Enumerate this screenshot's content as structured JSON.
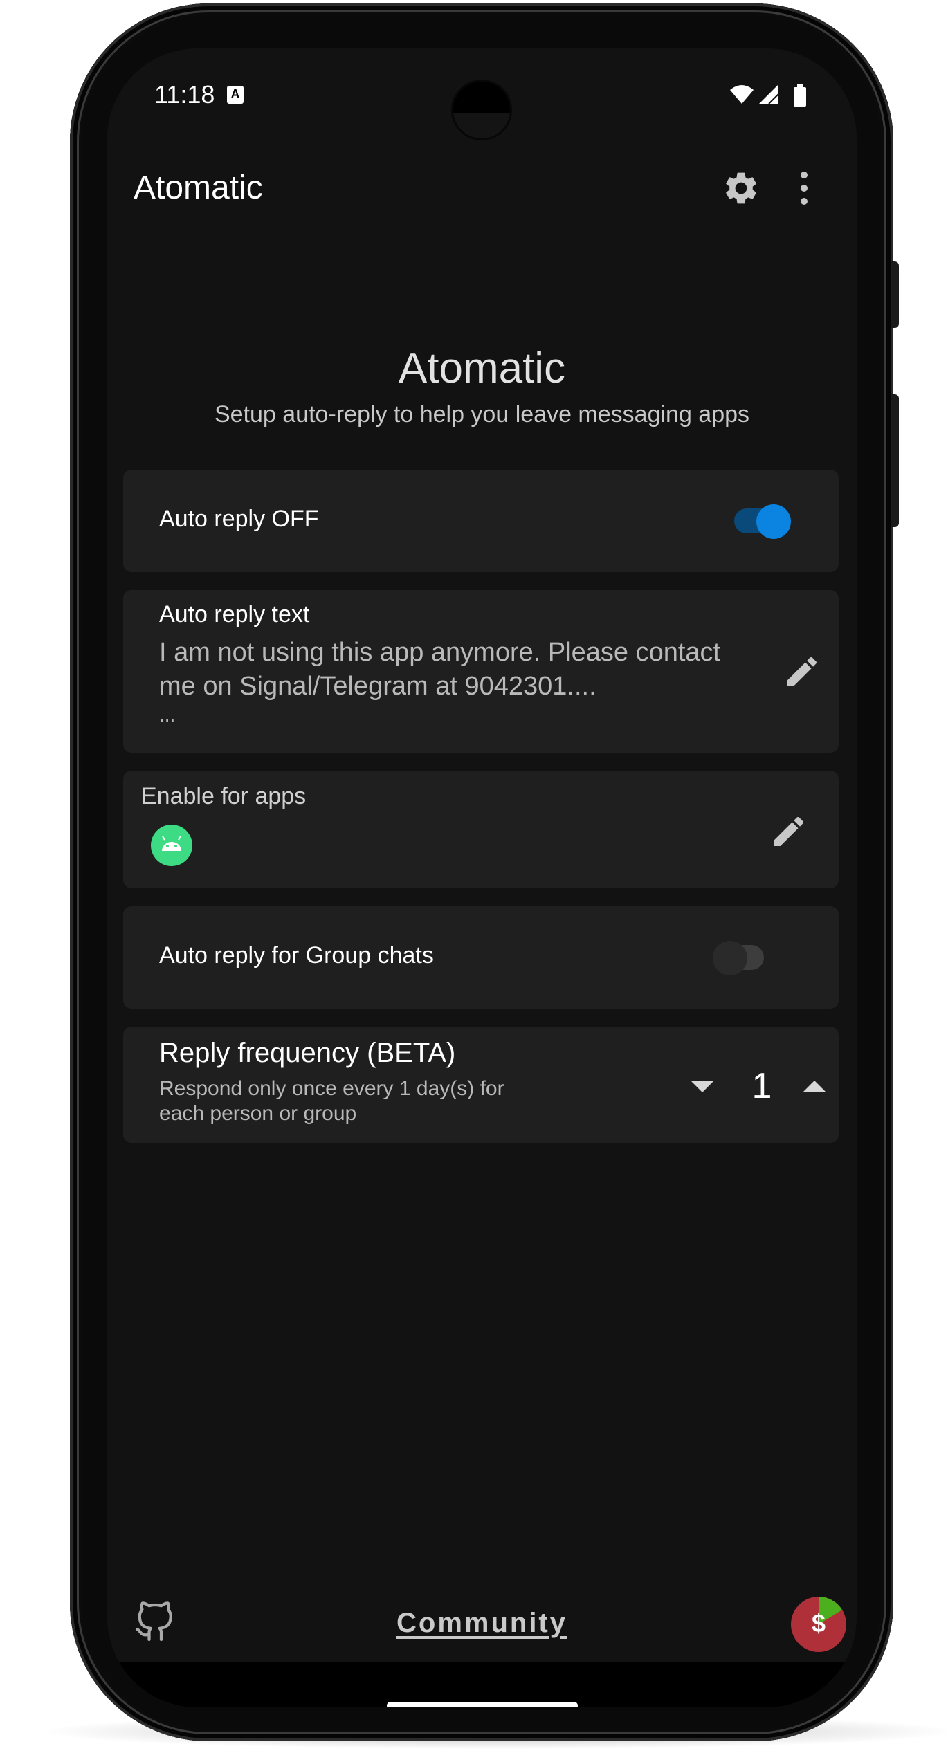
{
  "status_bar": {
    "time": "11:18",
    "notification_badge": "A"
  },
  "app_bar": {
    "title": "Atomatic",
    "settings_icon": "gear-icon",
    "menu_icon": "more-vert-icon"
  },
  "hero": {
    "title": "Atomatic",
    "subtitle": "Setup auto-reply to help you leave messaging apps"
  },
  "auto_reply_toggle": {
    "label": "Auto reply OFF",
    "checked": true,
    "accent": "#0a84e0"
  },
  "auto_reply_text": {
    "label": "Auto reply text",
    "line1": "I am not using this app anymore. Please contact",
    "line2": "me on Signal/Telegram at 9042301....",
    "line3": "..."
  },
  "enable_for_apps": {
    "label": "Enable for apps",
    "apps": [
      "android-app-icon"
    ]
  },
  "group_chats_toggle": {
    "label": "Auto reply for Group chats",
    "checked": false
  },
  "reply_frequency": {
    "title": "Reply frequency (BETA)",
    "subtitle": "Respond only once every 1 day(s) for each person or group",
    "value": "1"
  },
  "footer": {
    "community_link": "Community",
    "github_icon": "github-icon",
    "donate_icon": "donate-icon",
    "donate_symbol": "$"
  }
}
